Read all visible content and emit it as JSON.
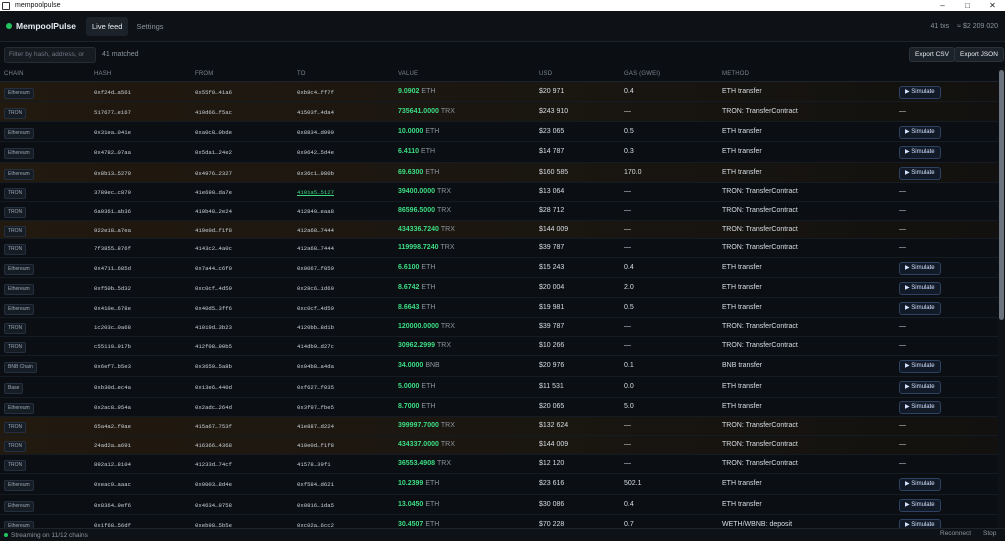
{
  "window": {
    "title": "mempoolpulse",
    "controls": [
      "–",
      "□",
      "✕"
    ]
  },
  "header": {
    "brand": "MempoolPulse",
    "tabs": [
      {
        "label": "Live feed",
        "active": true
      },
      {
        "label": "Settings",
        "active": false
      }
    ],
    "tx_count": "41 txs",
    "total_usd": "≈ $2 209 020"
  },
  "toolbar": {
    "search_placeholder": "Filter by hash, address, or",
    "matched": "41 matched",
    "export_csv": "Export CSV",
    "export_json": "Export JSON"
  },
  "columns": [
    "CHAIN",
    "HASH",
    "FROM",
    "TO",
    "VALUE",
    "USD",
    "GAS (GWEI)",
    "METHOD"
  ],
  "simulate_label": "▶ Simulate",
  "rows": [
    {
      "chain": "Ethereum",
      "hash": "0xf24d…a561",
      "from": "0x55f9…41a6",
      "to": "0xb9c4…ff7f",
      "value": "9.0902",
      "unit": "ETH",
      "usd": "$20 971",
      "gas": "0.4",
      "method": "ETH transfer",
      "sim": true,
      "hl": true
    },
    {
      "chain": "TRON",
      "hash": "517677…e167",
      "from": "419d66…f5ac",
      "to": "41503f…4da4",
      "value": "735641.0000",
      "unit": "TRX",
      "usd": "$243 910",
      "gas": "—",
      "method": "TRON: TransferContract",
      "sim": false,
      "hl": true
    },
    {
      "chain": "Ethereum",
      "hash": "0x31ea…041e",
      "from": "0xa0c8…0bde",
      "to": "0x8834…d099",
      "value": "10.0000",
      "unit": "ETH",
      "usd": "$23 065",
      "gas": "0.5",
      "method": "ETH transfer",
      "sim": true,
      "hl": false
    },
    {
      "chain": "Ethereum",
      "hash": "0x4782…07aa",
      "from": "0x5da1…24e2",
      "to": "0x9642…5d4e",
      "value": "6.4110",
      "unit": "ETH",
      "usd": "$14 787",
      "gas": "0.3",
      "method": "ETH transfer",
      "sim": true,
      "hl": false
    },
    {
      "chain": "Ethereum",
      "hash": "0x8b13…5279",
      "from": "0x4976…2327",
      "to": "0x36c1…980b",
      "value": "69.6300",
      "unit": "ETH",
      "usd": "$160 585",
      "gas": "170.0",
      "method": "ETH transfer",
      "sim": true,
      "hl": true
    },
    {
      "chain": "TRON",
      "hash": "3789ec…c879",
      "from": "41e690…da7e",
      "to": "4101a5…5127",
      "value": "39400.0000",
      "unit": "TRX",
      "usd": "$13 064",
      "gas": "—",
      "method": "TRON: TransferContract",
      "sim": false,
      "hl": false,
      "to_link": true
    },
    {
      "chain": "TRON",
      "hash": "6a0361…ab36",
      "from": "410b48…2e24",
      "to": "412849…eaa8",
      "value": "86596.5000",
      "unit": "TRX",
      "usd": "$28 712",
      "gas": "—",
      "method": "TRON: TransferContract",
      "sim": false,
      "hl": false
    },
    {
      "chain": "TRON",
      "hash": "922e18…a7ea",
      "from": "419e0d…f1f8",
      "to": "412a68…7444",
      "value": "434336.7240",
      "unit": "TRX",
      "usd": "$144 009",
      "gas": "—",
      "method": "TRON: TransferContract",
      "sim": false,
      "hl": true
    },
    {
      "chain": "TRON",
      "hash": "7f3855…876f",
      "from": "4143c2…4a0c",
      "to": "412a68…7444",
      "value": "119998.7240",
      "unit": "TRX",
      "usd": "$39 787",
      "gas": "—",
      "method": "TRON: TransferContract",
      "sim": false,
      "hl": false
    },
    {
      "chain": "Ethereum",
      "hash": "0x4711…685d",
      "from": "0x7a44…c6f0",
      "to": "0x0067…f859",
      "value": "6.6100",
      "unit": "ETH",
      "usd": "$15 243",
      "gas": "0.4",
      "method": "ETH transfer",
      "sim": true,
      "hl": false
    },
    {
      "chain": "Ethereum",
      "hash": "0xf50b…5d32",
      "from": "0xc0cf…4d59",
      "to": "0x28c6…1d60",
      "value": "8.6742",
      "unit": "ETH",
      "usd": "$20 004",
      "gas": "2.0",
      "method": "ETH transfer",
      "sim": true,
      "hl": false
    },
    {
      "chain": "Ethereum",
      "hash": "0x410e…678e",
      "from": "0x40d5…3ff6",
      "to": "0xc0cf…4d59",
      "value": "8.6643",
      "unit": "ETH",
      "usd": "$19 981",
      "gas": "0.5",
      "method": "ETH transfer",
      "sim": true,
      "hl": false
    },
    {
      "chain": "TRON",
      "hash": "1c203c…0a68",
      "from": "41019d…3b23",
      "to": "4120bb…8d1b",
      "value": "120000.0000",
      "unit": "TRX",
      "usd": "$39 787",
      "gas": "—",
      "method": "TRON: TransferContract",
      "sim": false,
      "hl": false
    },
    {
      "chain": "TRON",
      "hash": "c55119…917b",
      "from": "412f08…90b5",
      "to": "414db9…d27c",
      "value": "30962.2999",
      "unit": "TRX",
      "usd": "$10 266",
      "gas": "—",
      "method": "TRON: TransferContract",
      "sim": false,
      "hl": false
    },
    {
      "chain": "BNB Chain",
      "hash": "0x6ef7…b5e3",
      "from": "0x3659…5a8b",
      "to": "0x04b8…a4da",
      "value": "34.0000",
      "unit": "BNB",
      "usd": "$20 976",
      "gas": "0.1",
      "method": "BNB transfer",
      "sim": true,
      "hl": false
    },
    {
      "chain": "Base",
      "hash": "0xb30d…ec4a",
      "from": "0x13e6…440d",
      "to": "0xf627…f035",
      "value": "5.0000",
      "unit": "ETH",
      "usd": "$11 531",
      "gas": "0.0",
      "method": "ETH transfer",
      "sim": true,
      "hl": false
    },
    {
      "chain": "Ethereum",
      "hash": "0x2ac8…954a",
      "from": "0x2adc…264d",
      "to": "0x3f97…fbe5",
      "value": "8.7000",
      "unit": "ETH",
      "usd": "$20 065",
      "gas": "5.0",
      "method": "ETH transfer",
      "sim": true,
      "hl": false
    },
    {
      "chain": "TRON",
      "hash": "65a4a2…f9ae",
      "from": "415a67…753f",
      "to": "41e887…d224",
      "value": "399997.7000",
      "unit": "TRX",
      "usd": "$132 624",
      "gas": "—",
      "method": "TRON: TransferContract",
      "sim": false,
      "hl": true
    },
    {
      "chain": "TRON",
      "hash": "24ad2a…a691",
      "from": "416366…4368",
      "to": "419e0d…f1f8",
      "value": "434337.0000",
      "unit": "TRX",
      "usd": "$144 009",
      "gas": "—",
      "method": "TRON: TransferContract",
      "sim": false,
      "hl": true
    },
    {
      "chain": "TRON",
      "hash": "892a12…8104",
      "from": "41233d…74cf",
      "to": "41578…39f1",
      "value": "36553.4908",
      "unit": "TRX",
      "usd": "$12 120",
      "gas": "—",
      "method": "TRON: TransferContract",
      "sim": false,
      "hl": false
    },
    {
      "chain": "Ethereum",
      "hash": "0xeac9…aaac",
      "from": "0x0003…8d4e",
      "to": "0xf584…d621",
      "value": "10.2399",
      "unit": "ETH",
      "usd": "$23 616",
      "gas": "502.1",
      "method": "ETH transfer",
      "sim": true,
      "hl": false
    },
    {
      "chain": "Ethereum",
      "hash": "0x8364…9ef6",
      "from": "0x4634…9758",
      "to": "0x0816…1da5",
      "value": "13.0450",
      "unit": "ETH",
      "usd": "$30 086",
      "gas": "0.4",
      "method": "ETH transfer",
      "sim": true,
      "hl": false
    },
    {
      "chain": "Ethereum",
      "hash": "0x1f68…56df",
      "from": "0xeb98…5b5e",
      "to": "0xc02a…6cc2",
      "value": "30.4507",
      "unit": "ETH",
      "usd": "$70 228",
      "gas": "0.7",
      "method": "WETH/WBNB: deposit",
      "sim": true,
      "hl": false
    }
  ],
  "footer": {
    "status": "Streaming on 11/12 chains",
    "reconnect": "Reconnect",
    "stop": "Stop"
  },
  "colors": {
    "accent_green": "#3ddc84",
    "highlight_row": "#22190f",
    "background": "#0b0f13"
  },
  "icons": {
    "status_dot": "status-dot-icon",
    "simulate": "play-icon"
  }
}
